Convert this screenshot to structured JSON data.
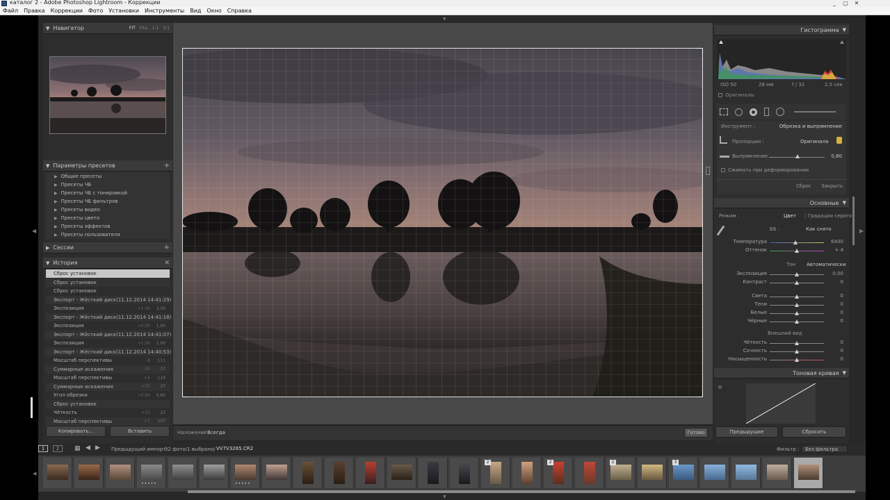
{
  "window": {
    "title": "каталог 2 - Adobe Photoshop Lightroom - Коррекции",
    "controls": [
      "_",
      "▢",
      "✕"
    ]
  },
  "menu": [
    "Файл",
    "Правка",
    "Коррекции",
    "Фото",
    "Установки",
    "Инструменты",
    "Вид",
    "Окно",
    "Справка"
  ],
  "navigator": {
    "title": "Навигатор",
    "zoom": [
      "FIT",
      "FILL",
      "1:1",
      "3:1"
    ]
  },
  "presets": {
    "title": "Параметры пресетов",
    "items": [
      "Общие пресеты",
      "Пресеты ЧБ",
      "Пресеты ЧБ с тонировкой",
      "Пресеты ЧБ фильтров",
      "Пресеты видео",
      "Пресеты цвета",
      "Пресеты эффектов",
      "Пресеты пользователя"
    ]
  },
  "sessions": {
    "title": "Сессии"
  },
  "history": {
    "title": "История",
    "items": [
      {
        "label": "Сброс установок",
        "v1": "",
        "v2": ""
      },
      {
        "label": "Сброс установок",
        "v1": "",
        "v2": ""
      },
      {
        "label": "Сброс установок",
        "v1": "",
        "v2": ""
      },
      {
        "label": "Экспорт - Жёсткий диск(11.12.2014 14:41:29)",
        "v1": "",
        "v2": ""
      },
      {
        "label": "Экспозиция",
        "v1": "+1,00",
        "v2": "3,00"
      },
      {
        "label": "Экспорт - Жёсткий диск(11.12.2014 14:41:18)",
        "v1": "",
        "v2": ""
      },
      {
        "label": "Экспозиция",
        "v1": "+0,90",
        "v2": "1,90"
      },
      {
        "label": "Экспорт - Жёсткий диск(11.12.2014 14:41:07)",
        "v1": "",
        "v2": ""
      },
      {
        "label": "Экспозиция",
        "v1": "+1,00",
        "v2": "1,00"
      },
      {
        "label": "Экспорт - Жёсткий диск(11.12.2014 14:40:53)",
        "v1": "",
        "v2": ""
      },
      {
        "label": "Масштаб перспективы",
        "v1": "-8",
        "v2": "111"
      },
      {
        "label": "Суммарные искажения",
        "v1": "-20",
        "v2": "37"
      },
      {
        "label": "Масштаб перспективы",
        "v1": "+4",
        "v2": "119"
      },
      {
        "label": "Суммарные искажения",
        "v1": "+37",
        "v2": "37"
      },
      {
        "label": "Угол обрезки",
        "v1": "+0,60",
        "v2": "0,60"
      },
      {
        "label": "Сброс установок",
        "v1": "",
        "v2": ""
      },
      {
        "label": "Чёткость",
        "v1": "+23",
        "v2": "23"
      },
      {
        "label": "Масштаб перспективы",
        "v1": "+7",
        "v2": "107"
      }
    ]
  },
  "left_buttons": {
    "copy": "Копировать...",
    "paste": "Вставить"
  },
  "toolbar": {
    "overlay_label": "Наложение :",
    "overlay_value": "Всегда",
    "done": "Готово"
  },
  "histogram": {
    "title": "Гистограмма",
    "iso": "ISO 50",
    "focal": "28 мм",
    "aperture": "f / 32",
    "shutter": "2,5 сек",
    "originals": "Оригиналы"
  },
  "crop": {
    "tool_label": "Инструмент :",
    "tool_value": "Обрезка и выпрямление",
    "aspect_label": "Пропорции :",
    "aspect_value": "Оригинала",
    "straighten_label": "Выпрямление",
    "straighten_value": "0,60",
    "warp_label": "Сжимать при деформировании",
    "reset": "Сброс",
    "close": "Закрыть"
  },
  "basic": {
    "title": "Основные",
    "mode_label": "Режим :",
    "mode_color": "Цвет",
    "mode_gray": "Градации серого",
    "wb_label": "ББ :",
    "wb_value": "Как снято",
    "temp_label": "Температура",
    "temp_value": "6400",
    "tint_label": "Оттенок",
    "tint_value": "+ 4",
    "tone_label": "Тон",
    "tone_auto": "Автоматически",
    "exposure_label": "Экспозиция",
    "exposure_value": "0,00",
    "contrast_label": "Контраст",
    "contrast_value": "0",
    "highlights_label": "Света",
    "highlights_value": "0",
    "shadows_label": "Тени",
    "shadows_value": "0",
    "whites_label": "Белые",
    "whites_value": "0",
    "blacks_label": "Чёрные",
    "blacks_value": "0",
    "presence_label": "Внешний вид",
    "clarity_label": "Чёткость",
    "clarity_value": "0",
    "vibrance_label": "Сочность",
    "vibrance_value": "0",
    "saturation_label": "Насыщенность",
    "saturation_value": "0"
  },
  "tonecurve": {
    "title": "Тоновая кривая"
  },
  "right_buttons": {
    "previous": "Предыдущие",
    "reset": "Сбросить"
  },
  "filmstrip": {
    "page1": "1",
    "page2": "2",
    "source": "Предыдущий импорт",
    "count": "32 фото/",
    "selected": "1 выбрано/",
    "filename": "VV7V3265.CR2",
    "filter_label": "Фильтр :",
    "filter_value": "Без фильтра"
  },
  "colors": {
    "accent": "#c7c7c7",
    "panel": "#2d2d2d",
    "canvas": "#484848"
  }
}
